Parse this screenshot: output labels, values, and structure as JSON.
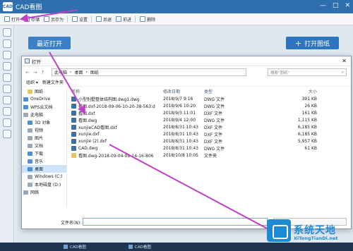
{
  "app": {
    "logo_text": "CAD",
    "title": "CAD看图",
    "window_controls": [
      "—",
      "□",
      "✕"
    ]
  },
  "toolbar": {
    "items": [
      "打开",
      "存储",
      "另存为",
      "设置",
      "后退",
      "前进",
      "删除"
    ]
  },
  "main": {
    "recent_label": "最近打开",
    "open_drawing_label": "打开图纸",
    "open_drawing_icon": "+"
  },
  "dialog": {
    "title": "打开",
    "close": "✕",
    "breadcrumb": [
      "此电脑",
      "桌面",
      "图纸"
    ],
    "search_placeholder": "搜索\"图纸\"",
    "organize": "组织 ▾",
    "new_folder": "新建文件夹",
    "nav_items": [
      {
        "label": "图纸",
        "kind": "folder"
      },
      {
        "label": "OneDrive",
        "kind": "blue"
      },
      {
        "label": "WPS云文档",
        "kind": "blue"
      },
      {
        "label": "此电脑",
        "kind": "gray"
      },
      {
        "label": "3D 对象",
        "kind": "blue"
      },
      {
        "label": "视频",
        "kind": "gray"
      },
      {
        "label": "图片",
        "kind": "gray"
      },
      {
        "label": "文档",
        "kind": "gray"
      },
      {
        "label": "下载",
        "kind": "blue"
      },
      {
        "label": "音乐",
        "kind": "blue"
      },
      {
        "label": "桌面",
        "kind": "blue",
        "selected": true
      },
      {
        "label": "Windows (C:)",
        "kind": "gray"
      },
      {
        "label": "本地磁盘 (D:)",
        "kind": "gray"
      },
      {
        "label": "网络",
        "kind": "gray"
      }
    ],
    "columns": [
      "名称",
      "修改日期",
      "类型",
      "大小"
    ],
    "files": [
      {
        "name": "小型别墅整体结构图.dwg1.dwg",
        "date": "2018/9/7 9:16",
        "type": "DWG 文件",
        "size": "391 KB",
        "folder": false
      },
      {
        "name": "看图.dxf-2018-09-06-10-20-38-563.d",
        "date": "2018/9/6 10:20",
        "type": "DWG 文件",
        "size": "26 KB",
        "folder": false
      },
      {
        "name": "看图.dxf",
        "date": "2018/9/3 11:01",
        "type": "DXF 文件",
        "size": "161 KB",
        "folder": false
      },
      {
        "name": "看图.dwg",
        "date": "2018/9/4 12:00",
        "type": "DWG 文件",
        "size": "1,115 KB",
        "folder": false
      },
      {
        "name": "xunjieCAD看图.dxf",
        "date": "2018/8/31 10:43",
        "type": "DXF 文件",
        "size": "6,185 KB",
        "folder": false
      },
      {
        "name": "xunjie.dxf",
        "date": "2018/8/31 10:43",
        "type": "DXF 文件",
        "size": "6,185 KB",
        "folder": false
      },
      {
        "name": "xunjie (2).dxf",
        "date": "2018/8/31 10:43",
        "type": "DXF 文件",
        "size": "5,957 KB",
        "folder": false
      },
      {
        "name": "CAD.dwg",
        "date": "2018/8/31 10:43",
        "type": "DWG 文件",
        "size": "61 KB",
        "folder": false
      },
      {
        "name": "看图.dwg-2018-09-04-09-14-16-806",
        "date": "2018/10/8 10:05",
        "type": "文件夹",
        "size": "",
        "folder": true
      }
    ],
    "filename_label": "文件名(N):"
  },
  "taskbar": {
    "items": [
      "CAD看图"
    ]
  },
  "watermark": {
    "title": "系统天地",
    "url": "XiTongTianDi.net"
  },
  "colors": {
    "title_bar": "#2f6fad",
    "accent_button": "#2f74bf",
    "annotation_arrow": "#c040c8",
    "watermark": "#1d8ad6"
  }
}
